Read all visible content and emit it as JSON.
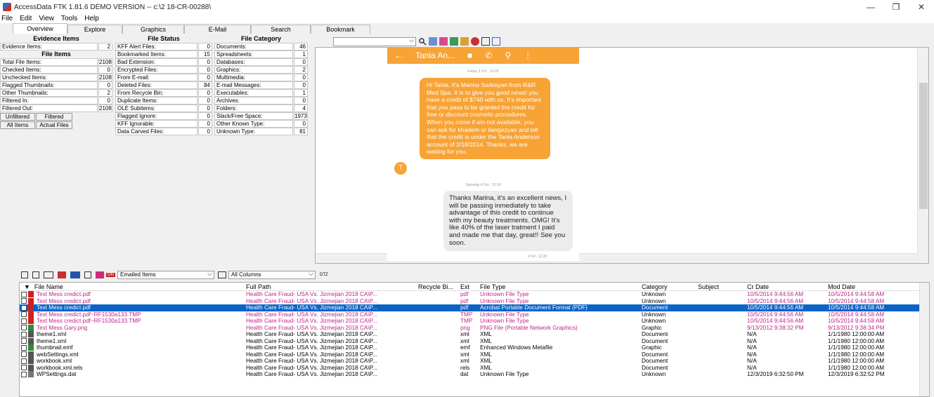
{
  "window": {
    "title": "AccessData FTK 1.81.6 DEMO VERSION -- c:\\2 18-CR-00288\\",
    "minimize": "—",
    "restore": "❐",
    "close": "✕"
  },
  "menu": [
    "File",
    "Edit",
    "View",
    "Tools",
    "Help"
  ],
  "tabs": [
    "Overview",
    "Explore",
    "Graphics",
    "E-Mail",
    "Search",
    "Bookmark"
  ],
  "evidence": {
    "title": "Evidence Items",
    "evidence_items": {
      "label": "Evidence Items:",
      "value": "2"
    },
    "file_items_title": "File Items",
    "rows": [
      {
        "label": "Total File Items:",
        "value": "2108"
      },
      {
        "label": "Checked Items:",
        "value": "0"
      },
      {
        "label": "Unchecked Items:",
        "value": "2108"
      },
      {
        "label": "Flagged Thumbnails:",
        "value": "0"
      },
      {
        "label": "Other Thumbnails:",
        "value": "2"
      },
      {
        "label": "Filtered In:",
        "value": "0"
      },
      {
        "label": "Filtered Out:",
        "value": "2108"
      }
    ],
    "buttons": [
      "Unfiltered",
      "Filtered",
      "All Items",
      "Actual Files"
    ]
  },
  "file_status": {
    "title": "File Status",
    "rows": [
      {
        "label": "KFF Alert Files:",
        "value": "0"
      },
      {
        "label": "Bookmarked Items:",
        "value": "15"
      },
      {
        "label": "Bad Extension:",
        "value": "0"
      },
      {
        "label": "Encrypted Files:",
        "value": "0"
      },
      {
        "label": "From E-mail:",
        "value": "0"
      },
      {
        "label": "Deleted Files:",
        "value": "84"
      },
      {
        "label": "From Recycle Bin:",
        "value": "0"
      },
      {
        "label": "Duplicate Items:",
        "value": "0"
      },
      {
        "label": "OLE Subitems:",
        "value": "0"
      },
      {
        "label": "Flagged Ignore:",
        "value": "0"
      },
      {
        "label": "KFF Ignorable:",
        "value": "0"
      },
      {
        "label": "Data Carved Files:",
        "value": "0"
      }
    ]
  },
  "file_category": {
    "title": "File Category",
    "rows": [
      {
        "label": "Documents:",
        "value": "46"
      },
      {
        "label": "Spreadsheets:",
        "value": "1"
      },
      {
        "label": "Databases:",
        "value": "0"
      },
      {
        "label": "Graphics:",
        "value": "2"
      },
      {
        "label": "Multimedia:",
        "value": "0"
      },
      {
        "label": "E-mail Messages:",
        "value": "0"
      },
      {
        "label": "Executables:",
        "value": "1"
      },
      {
        "label": "Archives:",
        "value": "0"
      },
      {
        "label": "Folders:",
        "value": "4"
      },
      {
        "label": "Slack/Free Space:",
        "value": "1973"
      },
      {
        "label": "Other Known Type:",
        "value": "0"
      },
      {
        "label": "Unknown Type:",
        "value": "81"
      }
    ]
  },
  "chat": {
    "contact": "Tania An...",
    "date1": "Friday 3 Oct · 10:25",
    "incoming": "Hi Tania, It's Marina Sarkisyan from R&R Med Spa. It is to give you good news! you have a credit of $740 with us. It's important that you pass to be granted the credit for free or discount cosmetic procedures. When you come if am not available, you can ask for khadem or liangezyan and tell that the credit is under the Tania Anderson account of 2/18/2014. Thanks, we are waiting for you.",
    "avatar": "T",
    "date2": "Saturday 4 Oct · 12:24",
    "outgoing": "Thanks Marina, it's an excellent news, I will be passing inmediately to take advantage of this credit to continue with my beauty treatments. OMG! It's like 40% of the laser tratment I paid and made me that day, great!! See you soon.",
    "out_time": "4 Oct, 12:28"
  },
  "list_toolbar": {
    "filter": "Emailed Items",
    "columns": "All Columns",
    "dtz": "DTZ",
    "on_badge": "ON"
  },
  "columns": [
    "File Name",
    "Full Path",
    "Recycle Bi...",
    "Ext",
    "File Type",
    "Category",
    "Subject",
    "Cr Date",
    "Mod Date"
  ],
  "rows": [
    {
      "name": "Text Mess credict.pdf",
      "path": "Health Care Fraud- USA Vs. Jizmejian 2018 CA\\P...",
      "recycle": "",
      "ext": "pdf",
      "type": "Unknown File Type",
      "category": "Unknown",
      "subject": "",
      "cr": "10/5/2014 9:44:56 AM",
      "mod": "10/5/2014 9:44:58 AM",
      "icon": "pdf",
      "hl": true,
      "sel": false
    },
    {
      "name": "Text Mess credict.pdf",
      "path": "Health Care Fraud- USA Vs. Jizmejian 2018 CA\\P...",
      "recycle": "",
      "ext": "pdf",
      "type": "Unknown File Type",
      "category": "Unknown",
      "subject": "",
      "cr": "10/5/2014 9:44:56 AM",
      "mod": "10/5/2014 9:44:58 AM",
      "icon": "pdf",
      "hl": true,
      "sel": false
    },
    {
      "name": "Text Mess credict.pdf",
      "path": "Health Care Fraud- USA Vs. Jizmejian 2018 CA\\P...",
      "recycle": "",
      "ext": "pdf",
      "type": "Acrobat Portable Document Format (PDF)",
      "category": "Document",
      "subject": "",
      "cr": "10/5/2014 9:44:56 AM",
      "mod": "10/5/2014 9:44:58 AM",
      "icon": "pdf",
      "hl": true,
      "sel": true
    },
    {
      "name": "Text Mess credict.pdf~RF1530a133.TMP",
      "path": "Health Care Fraud- USA Vs. Jizmejian 2018 CA\\P...",
      "recycle": "",
      "ext": "TMP",
      "type": "Unknown File Type",
      "category": "Unknown",
      "subject": "",
      "cr": "10/5/2014 9:44:56 AM",
      "mod": "10/5/2014 9:44:58 AM",
      "icon": "pdf",
      "hl": true,
      "sel": false
    },
    {
      "name": "Text Mess credict.pdf~RF1530a133.TMP",
      "path": "Health Care Fraud- USA Vs. Jizmejian 2018 CA\\P...",
      "recycle": "",
      "ext": "TMP",
      "type": "Unknown File Type",
      "category": "Unknown",
      "subject": "",
      "cr": "10/5/2014 9:44:56 AM",
      "mod": "10/5/2014 9:44:58 AM",
      "icon": "pdf",
      "hl": true,
      "sel": false
    },
    {
      "name": "Text Mess Gary.png",
      "path": "Health Care Fraud- USA Vs. Jizmejian 2018 CA\\P...",
      "recycle": "",
      "ext": "png",
      "type": "PNG File (Portable Network Graphics)",
      "category": "Graphic",
      "subject": "",
      "cr": "9/13/2012 9:38:32 PM",
      "mod": "9/13/2012 9:38:34 PM",
      "icon": "img",
      "hl": true,
      "sel": false
    },
    {
      "name": "theme1.xml",
      "path": "Health Care Fraud- USA Vs. Jizmejian 2018 CA\\P...",
      "recycle": "",
      "ext": "xml",
      "type": "XML",
      "category": "Document",
      "subject": "",
      "cr": "N/A",
      "mod": "1/1/1980 12:00:00 AM",
      "icon": "doc",
      "hl": false,
      "sel": false
    },
    {
      "name": "theme1.xml",
      "path": "Health Care Fraud- USA Vs. Jizmejian 2018 CA\\P...",
      "recycle": "",
      "ext": "xml",
      "type": "XML",
      "category": "Document",
      "subject": "",
      "cr": "N/A",
      "mod": "1/1/1980 12:00:00 AM",
      "icon": "doc",
      "hl": false,
      "sel": false
    },
    {
      "name": "thumbnail.emf",
      "path": "Health Care Fraud- USA Vs. Jizmejian 2018 CA\\P...",
      "recycle": "",
      "ext": "emf",
      "type": "Enhanced Windows Metafile",
      "category": "Graphic",
      "subject": "",
      "cr": "N/A",
      "mod": "1/1/1980 12:00:00 AM",
      "icon": "img",
      "hl": false,
      "sel": false
    },
    {
      "name": "webSettings.xml",
      "path": "Health Care Fraud- USA Vs. Jizmejian 2018 CA\\P...",
      "recycle": "",
      "ext": "xml",
      "type": "XML",
      "category": "Document",
      "subject": "",
      "cr": "N/A",
      "mod": "1/1/1980 12:00:00 AM",
      "icon": "doc",
      "hl": false,
      "sel": false
    },
    {
      "name": "workbook.xml",
      "path": "Health Care Fraud- USA Vs. Jizmejian 2018 CA\\P...",
      "recycle": "",
      "ext": "xml",
      "type": "XML",
      "category": "Document",
      "subject": "",
      "cr": "N/A",
      "mod": "1/1/1980 12:00:00 AM",
      "icon": "doc",
      "hl": false,
      "sel": false
    },
    {
      "name": "workbook.xml.rels",
      "path": "Health Care Fraud- USA Vs. Jizmejian 2018 CA\\P...",
      "recycle": "",
      "ext": "rels",
      "type": "XML",
      "category": "Document",
      "subject": "",
      "cr": "N/A",
      "mod": "1/1/1980 12:00:00 AM",
      "icon": "doc",
      "hl": false,
      "sel": false
    },
    {
      "name": "WPSettings.dat",
      "path": "Health Care Fraud- USA Vs. Jizmejian 2018 CA\\P...",
      "recycle": "",
      "ext": "dat",
      "type": "Unknown File Type",
      "category": "Unknown",
      "subject": "",
      "cr": "12/3/2019 6:32:50 PM",
      "mod": "12/3/2019 6:32:52 PM",
      "icon": "unk",
      "hl": false,
      "sel": false
    }
  ]
}
